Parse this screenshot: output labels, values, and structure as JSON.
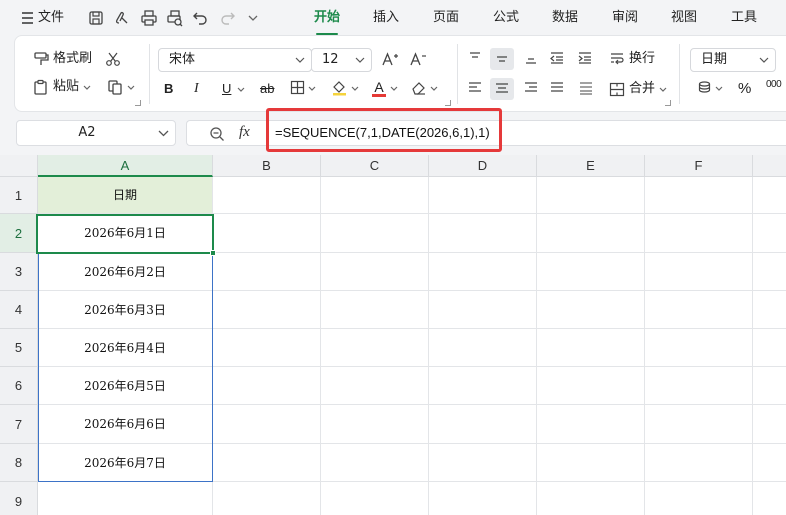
{
  "menubar": {
    "file_label": "文件",
    "tabs": [
      {
        "label": "开始",
        "active": true
      },
      {
        "label": "插入"
      },
      {
        "label": "页面"
      },
      {
        "label": "公式"
      },
      {
        "label": "数据"
      },
      {
        "label": "审阅"
      },
      {
        "label": "视图"
      },
      {
        "label": "工具"
      }
    ]
  },
  "ribbon": {
    "format_painter": "格式刷",
    "paste": "粘贴",
    "font_name": "宋体",
    "font_size": "12",
    "wrap_text": "换行",
    "merge": "合并",
    "number_format": "日期",
    "bold": "B",
    "italic": "I",
    "underline": "U",
    "strike": "ab",
    "percent": "%",
    "thousands": "000",
    "font_color_letter": "A"
  },
  "colors": {
    "accent": "#1d8a4b",
    "highlight_box": "#e5393a",
    "header_fill": "#e3efd9",
    "range_border": "#3d73c7"
  },
  "formula_bar": {
    "name_box": "A2",
    "fx_label": "fx",
    "formula": "=SEQUENCE(7,1,DATE(2026,6,1),1)"
  },
  "sheet": {
    "columns": [
      "A",
      "B",
      "C",
      "D",
      "E",
      "F"
    ],
    "rows": [
      "1",
      "2",
      "3",
      "4",
      "5",
      "6",
      "7",
      "8",
      "9"
    ],
    "header_cell": "日期",
    "dates": [
      "2026年6月1日",
      "2026年6月2日",
      "2026年6月3日",
      "2026年6月4日",
      "2026年6月5日",
      "2026年6月6日",
      "2026年6月7日"
    ]
  }
}
